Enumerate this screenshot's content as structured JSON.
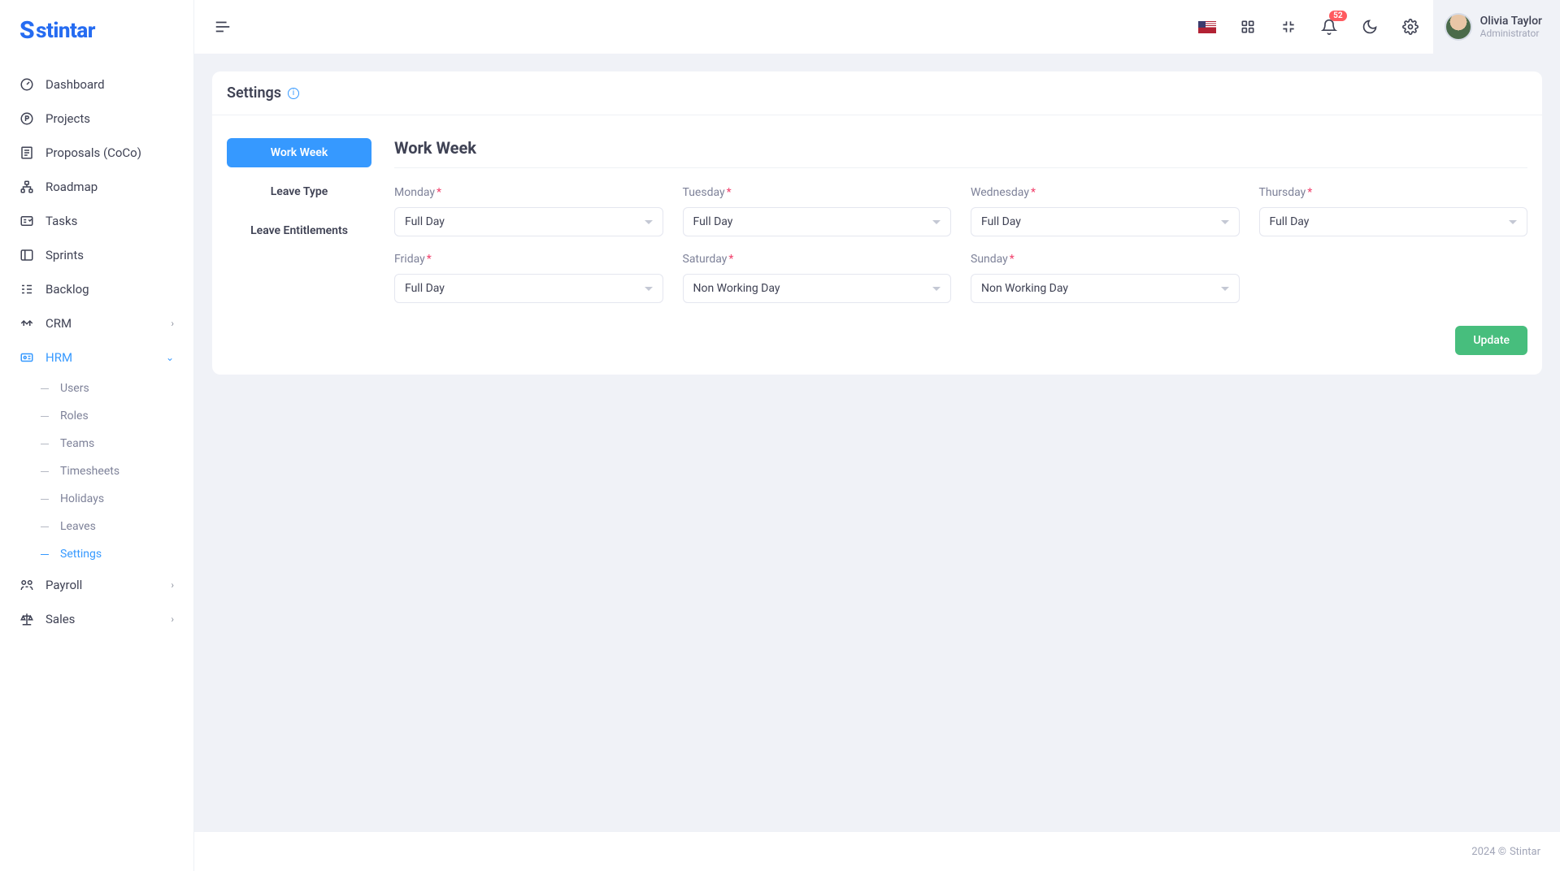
{
  "app": {
    "name": "Stintar"
  },
  "header": {
    "notification_count": "52",
    "user": {
      "name": "Olivia Taylor",
      "role": "Administrator"
    }
  },
  "sidebar": {
    "items": [
      {
        "label": "Dashboard"
      },
      {
        "label": "Projects"
      },
      {
        "label": "Proposals (CoCo)"
      },
      {
        "label": "Roadmap"
      },
      {
        "label": "Tasks"
      },
      {
        "label": "Sprints"
      },
      {
        "label": "Backlog"
      },
      {
        "label": "CRM"
      },
      {
        "label": "HRM"
      },
      {
        "label": "Payroll"
      },
      {
        "label": "Sales"
      }
    ],
    "hrm_sub": [
      {
        "label": "Users"
      },
      {
        "label": "Roles"
      },
      {
        "label": "Teams"
      },
      {
        "label": "Timesheets"
      },
      {
        "label": "Holidays"
      },
      {
        "label": "Leaves"
      },
      {
        "label": "Settings"
      }
    ]
  },
  "page": {
    "title": "Settings",
    "tabs": [
      {
        "label": "Work Week"
      },
      {
        "label": "Leave Type"
      },
      {
        "label": "Leave Entitlements"
      }
    ],
    "section_title": "Work Week",
    "days": [
      {
        "label": "Monday",
        "value": "Full Day"
      },
      {
        "label": "Tuesday",
        "value": "Full Day"
      },
      {
        "label": "Wednesday",
        "value": "Full Day"
      },
      {
        "label": "Thursday",
        "value": "Full Day"
      },
      {
        "label": "Friday",
        "value": "Full Day"
      },
      {
        "label": "Saturday",
        "value": "Non Working Day"
      },
      {
        "label": "Sunday",
        "value": "Non Working Day"
      }
    ],
    "update_label": "Update"
  },
  "footer": {
    "copyright": "2024 ©",
    "brand": "Stintar"
  }
}
